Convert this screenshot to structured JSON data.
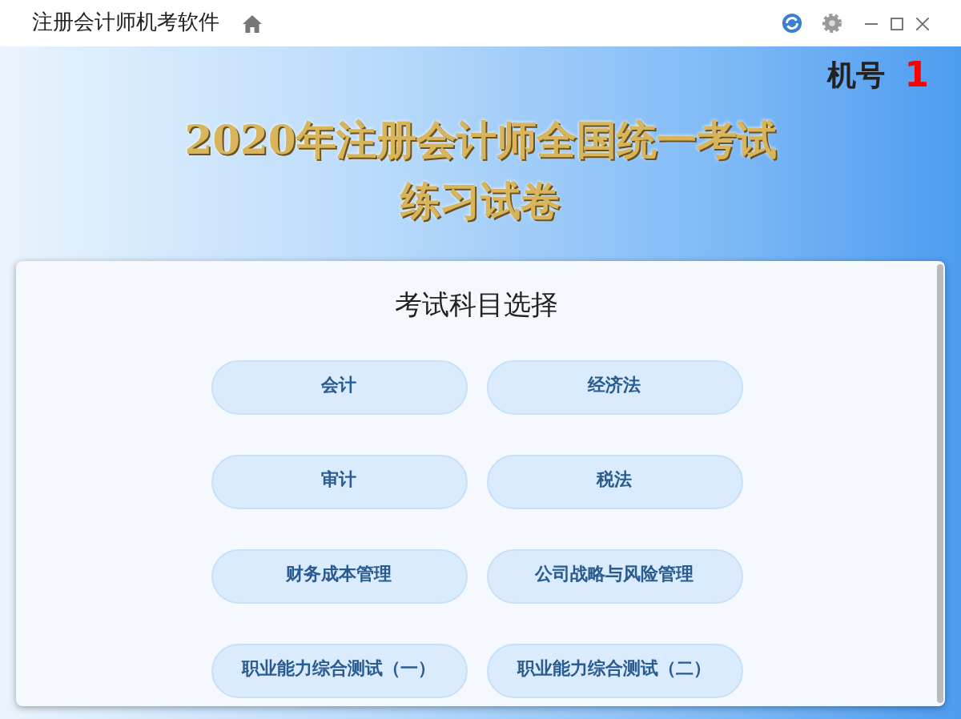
{
  "window": {
    "title": "注册会计师机考软件"
  },
  "banner": {
    "machine_label": "机号",
    "machine_number": "1",
    "title_lines": [
      "2020年注册会计师全国统一考试",
      "练习试卷"
    ]
  },
  "panel": {
    "heading": "考试科目选择",
    "subjects": [
      "会计",
      "经济法",
      "审计",
      "税法",
      "财务成本管理",
      "公司战略与风险管理",
      "职业能力综合测试（一）",
      "职业能力综合测试（二）"
    ]
  }
}
